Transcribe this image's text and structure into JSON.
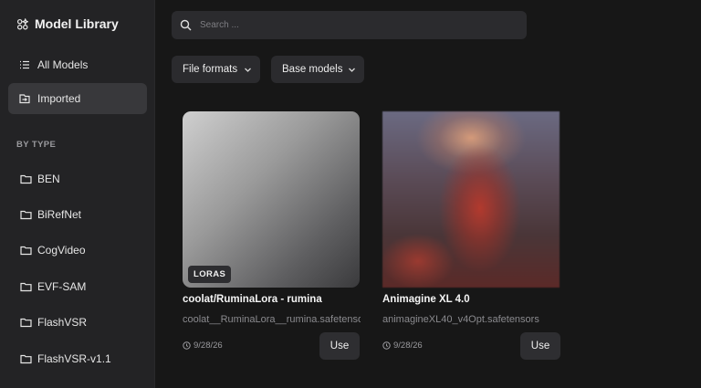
{
  "sidebar": {
    "title": "Model Library",
    "nav": [
      {
        "label": "All Models",
        "icon": "list-icon",
        "active": false
      },
      {
        "label": "Imported",
        "icon": "import-icon",
        "active": true
      }
    ],
    "section_label": "BY TYPE",
    "types": [
      {
        "label": "BEN",
        "icon": "folder-icon"
      },
      {
        "label": "BiRefNet",
        "icon": "folder-icon"
      },
      {
        "label": "CogVideo",
        "icon": "folder-icon"
      },
      {
        "label": "EVF-SAM",
        "icon": "folder-icon"
      },
      {
        "label": "FlashVSR",
        "icon": "folder-icon"
      },
      {
        "label": "FlashVSR-v1.1",
        "icon": "folder-icon"
      }
    ]
  },
  "search": {
    "placeholder": "Search ..."
  },
  "filters": [
    {
      "label": "File formats"
    },
    {
      "label": "Base models"
    }
  ],
  "cards": [
    {
      "badge": "LORAS",
      "title": "coolat/RuminaLora - rumina",
      "file": "coolat__RuminaLora__rumina.safetensors",
      "date": "9/28/26",
      "action": "Use"
    },
    {
      "badge": "",
      "title": "Animagine XL 4.0",
      "file": "animagineXL40_v4Opt.safetensors",
      "date": "9/28/26",
      "action": "Use"
    }
  ],
  "colors": {
    "background": "#171717",
    "sidebar": "#232325",
    "active_item": "#38383b",
    "control": "#2b2b2e"
  }
}
